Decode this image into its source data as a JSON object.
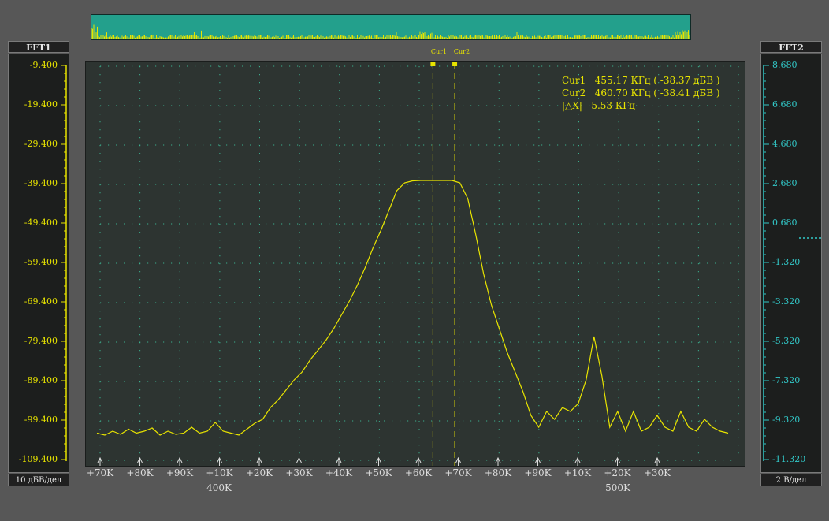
{
  "left_axis": {
    "title": "FFT1",
    "footer": "10 дБВ/дел",
    "ticks": [
      "-9.400",
      "-19.400",
      "-29.400",
      "-39.400",
      "-49.400",
      "-59.400",
      "-69.400",
      "-79.400",
      "-89.400",
      "-99.400",
      "-109.400"
    ],
    "color": "#e8e400"
  },
  "right_axis": {
    "title": "FFT2",
    "footer": "2 В/дел",
    "ticks": [
      "8.680",
      "6.680",
      "4.680",
      "2.680",
      "0.680",
      "-1.320",
      "-3.320",
      "-5.320",
      "-7.320",
      "-9.320",
      "-11.320"
    ],
    "color": "#32c8c8"
  },
  "cursors": {
    "cur1_label": "Cur1",
    "cur2_label": "Cur2",
    "readout": [
      {
        "name": "Cur1",
        "value": "455.17 КГц ( -38.37 дБВ )"
      },
      {
        "name": "Cur2",
        "value": "460.70 КГц ( -38.41 дБВ )"
      },
      {
        "name": "|△X|",
        "value": "5.53 КГц"
      }
    ]
  },
  "x_ticks": [
    "+70K",
    "+80K",
    "+90K",
    "+10K",
    "+20K",
    "+30K",
    "+40K",
    "+50K",
    "+60K",
    "+70K",
    "+80K",
    "+90K",
    "+10K",
    "+20K",
    "+30K"
  ],
  "x_major": [
    "400K",
    "500K"
  ],
  "chart_data": {
    "type": "line",
    "series": [
      {
        "x_khz": [
          370,
          372,
          374,
          376,
          378,
          380,
          382,
          384,
          386,
          388,
          390,
          392,
          394,
          396,
          398,
          400,
          402,
          404,
          406,
          408,
          410,
          412,
          414,
          416,
          418,
          420,
          422,
          424,
          426,
          428,
          430,
          432,
          434,
          436,
          438,
          440,
          442,
          444,
          446,
          448,
          450,
          452,
          454,
          456,
          458,
          460,
          462,
          464,
          466,
          468,
          470,
          472,
          474,
          476,
          478,
          480,
          482,
          484,
          486,
          488,
          490,
          492,
          494,
          496,
          498,
          500,
          502,
          504,
          506,
          508,
          510,
          512,
          514,
          516,
          518,
          520,
          522,
          524,
          526,
          528,
          530
        ],
        "y_dbv": [
          -102.5,
          -103,
          -102,
          -102.8,
          -101.5,
          -102.5,
          -102,
          -101.2,
          -103,
          -102,
          -102.8,
          -102.5,
          -101,
          -102.5,
          -102,
          -99.8,
          -102,
          -102.5,
          -103,
          -101.5,
          -100,
          -99,
          -96,
          -94,
          -91.5,
          -89,
          -87,
          -84,
          -81.5,
          -79,
          -76,
          -72.5,
          -69,
          -65,
          -60.5,
          -55.5,
          -51,
          -46,
          -41,
          -39,
          -38.5,
          -38.4,
          -38.4,
          -38.4,
          -38.4,
          -38.4,
          -39,
          -43,
          -52,
          -62,
          -70,
          -76,
          -82,
          -87,
          -92,
          -98,
          -101,
          -97,
          -99,
          -96,
          -97,
          -95,
          -89,
          -78,
          -88,
          -101,
          -97,
          -102,
          -97,
          -102,
          -101,
          -98,
          -101,
          -102,
          -97,
          -101,
          -102,
          -99,
          -101,
          -102,
          -102.5
        ],
        "color": "#e8e400"
      }
    ],
    "ylim": [
      -110,
      -10
    ]
  },
  "overview_color": "#23a08c"
}
